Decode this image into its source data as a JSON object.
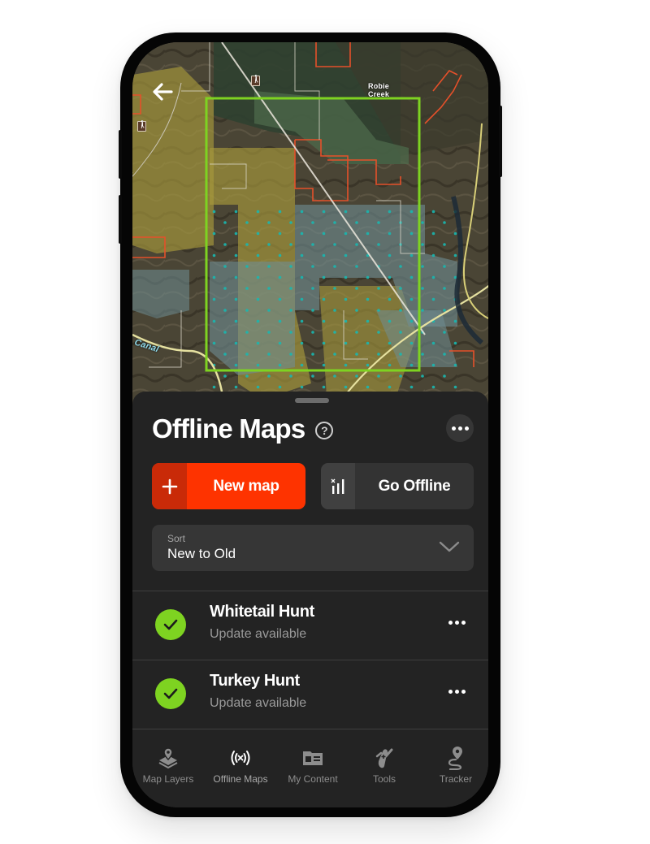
{
  "map": {
    "labels": {
      "creek": "Robie Creek",
      "canal": "Canal"
    },
    "colors": {
      "selection": "#7ed321",
      "boundary_red": "#e5502a",
      "boundary_white": "#d9d6c8",
      "dot_teal": "#18b7b0"
    }
  },
  "sheet": {
    "title": "Offline Maps",
    "help_icon": "question-circle-icon",
    "more_icon": "ellipsis-icon",
    "new_map_label": "New map",
    "go_offline_label": "Go Offline",
    "sort": {
      "label": "Sort",
      "value": "New to Old"
    },
    "items": [
      {
        "title": "Whitetail Hunt",
        "status": "Update available"
      },
      {
        "title": "Turkey Hunt",
        "status": "Update available"
      }
    ],
    "colors": {
      "accent": "#fe3300",
      "accent_dark": "#c92a08",
      "check_green": "#7ed321",
      "surface": "#232323"
    }
  },
  "tabs": [
    {
      "label": "Map Layers",
      "icon": "map-layers-icon",
      "active": false
    },
    {
      "label": "Offline Maps",
      "icon": "offline-signal-icon",
      "active": true
    },
    {
      "label": "My Content",
      "icon": "folder-content-icon",
      "active": false
    },
    {
      "label": "Tools",
      "icon": "multitool-icon",
      "active": false
    },
    {
      "label": "Tracker",
      "icon": "route-pin-icon",
      "active": false
    }
  ]
}
